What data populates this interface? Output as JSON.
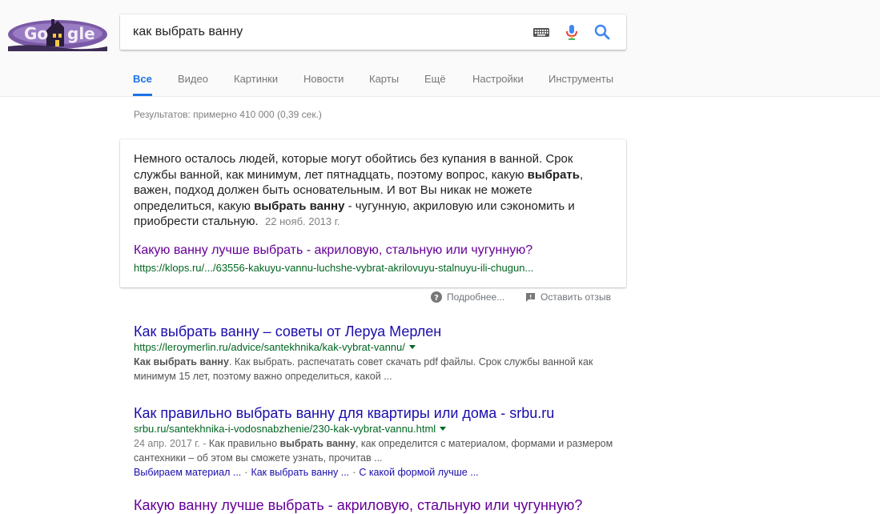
{
  "search": {
    "query": "как выбрать ванну",
    "icons": [
      "keyboard-icon",
      "microphone-icon",
      "search-icon"
    ]
  },
  "tabs": [
    {
      "label": "Все",
      "active": true
    },
    {
      "label": "Видео"
    },
    {
      "label": "Картинки"
    },
    {
      "label": "Новости"
    },
    {
      "label": "Карты"
    },
    {
      "label": "Ещё"
    },
    {
      "label": "Настройки"
    },
    {
      "label": "Инструменты"
    }
  ],
  "stats": "Результатов: примерно 410 000 (0,39 сек.)",
  "snippet": {
    "text_1": "Немного осталось людей, которые могут обойтись без купания в ванной. Срок службы ванной, как минимум, лет пятнадцать, поэтому вопрос, какую ",
    "bold_1": "выбрать",
    "text_2": ", важен, подход должен быть основательным. И вот Вы никак не можете определиться, какую ",
    "bold_2": "выбрать ванну",
    "text_3": " - чугунную, акриловую или сэкономить и приобрести стальную.",
    "date": "22 нояб. 2013 г.",
    "link_title": "Какую ванну лучше выбрать - акриловую, стальную или чугунную?",
    "url": "https://klops.ru/.../63556-kakuyu-vannu-luchshe-vybrat-akrilovuyu-stalnuyu-ili-chugun..."
  },
  "feedback": {
    "more": "Подробнее...",
    "review": "Оставить отзыв"
  },
  "results": [
    {
      "title": "Как выбрать ванну – советы от Леруа Мерлен",
      "url": "https://leroymerlin.ru/advice/santekhnika/kak-vybrat-vannu/",
      "desc_bold": "Как выбрать ванну",
      "desc": ". Как выбрать. распечатать совет скачать pdf файлы. Срок службы ванной как минимум 15 лет, поэтому важно определиться, какой ..."
    },
    {
      "title": "Как правильно выбрать ванну для квартиры или дома - srbu.ru",
      "url": "srbu.ru/santekhnika-i-vodosnabzhenie/230-kak-vybrat-vannu.html",
      "date": "24 апр. 2017 г. -",
      "desc_1": " Как правильно ",
      "desc_bold": "выбрать ванну",
      "desc_2": ", как определится с материалом, формами и размером сантехники – об этом вы сможете узнать, прочитав ...",
      "sitelinks": [
        "Выбираем материал ...",
        "Как выбрать ванну ...",
        "С какой формой лучше ..."
      ]
    },
    {
      "title": "Какую ванну лучше выбрать - акриловую, стальную или чугунную?"
    }
  ]
}
